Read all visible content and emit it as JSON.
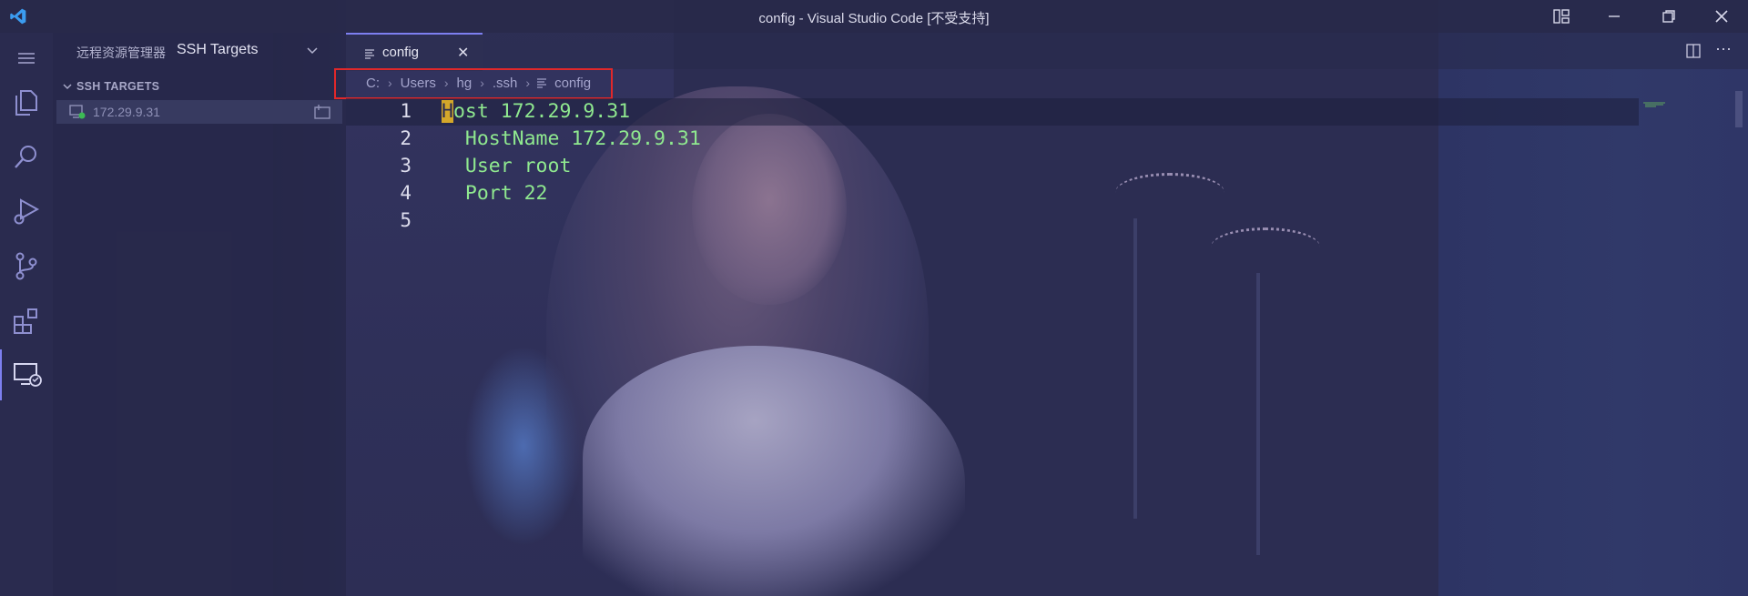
{
  "titlebar": {
    "title": "config - Visual Studio Code [不受支持]",
    "logo_icon": "vscode-logo-icon",
    "buttons": [
      "layout-icon",
      "minimize-icon",
      "restore-icon",
      "close-icon"
    ]
  },
  "activity_bar": {
    "items": [
      "menu-icon",
      "explorer-icon",
      "search-icon",
      "run-debug-icon",
      "source-control-icon",
      "extensions-icon",
      "remote-explorer-icon"
    ],
    "active": "remote-explorer-icon"
  },
  "sidebar": {
    "header": "远程资源管理器",
    "selected_view": "SSH Targets",
    "section_title": "SSH TARGETS",
    "targets": [
      {
        "label": "172.29.9.31"
      }
    ]
  },
  "editor": {
    "tab": {
      "label": "config"
    },
    "breadcrumb": [
      "C:",
      "Users",
      "hg",
      ".ssh",
      "config"
    ],
    "line_numbers": [
      "1",
      "2",
      "3",
      "4",
      "5"
    ],
    "lines": [
      {
        "first_char": "H",
        "rest": "ost 172.29.9.31"
      },
      {
        "text": "  HostName 172.29.9.31"
      },
      {
        "text": "  User root"
      },
      {
        "text": "  Port 22"
      },
      {
        "text": ""
      }
    ]
  },
  "colors": {
    "accent": "#7d7ff0",
    "code_text": "#8fe88f",
    "highlight_box": "#e0282a",
    "cursor": "#d4a72a"
  }
}
